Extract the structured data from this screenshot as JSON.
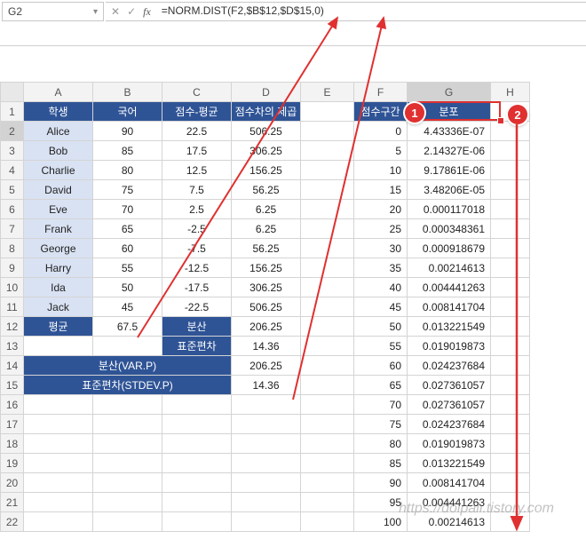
{
  "domain": "Computer-Use",
  "formula_bar": {
    "cell_ref": "G2",
    "cancel": "✕",
    "confirm": "✓",
    "fx": "fx",
    "formula": "=NORM.DIST(F2,$B$12,$D$15,0)"
  },
  "col_headers": [
    "A",
    "B",
    "C",
    "D",
    "E",
    "F",
    "G",
    "H"
  ],
  "row_headers": [
    "1",
    "2",
    "3",
    "4",
    "5",
    "6",
    "7",
    "8",
    "9",
    "10",
    "11",
    "12",
    "13",
    "14",
    "15",
    "16",
    "17",
    "18",
    "19",
    "20",
    "21",
    "22"
  ],
  "headers_left": {
    "a": "학생",
    "b": "국어",
    "c": "점수-평균",
    "d": "점수차의 제곱"
  },
  "headers_right": {
    "f": "점수구간",
    "g": "분포"
  },
  "students": [
    {
      "name": "Alice",
      "score": 90,
      "diff": "22.5",
      "sq": "506.25"
    },
    {
      "name": "Bob",
      "score": 85,
      "diff": "17.5",
      "sq": "306.25"
    },
    {
      "name": "Charlie",
      "score": 80,
      "diff": "12.5",
      "sq": "156.25"
    },
    {
      "name": "David",
      "score": 75,
      "diff": "7.5",
      "sq": "56.25"
    },
    {
      "name": "Eve",
      "score": 70,
      "diff": "2.5",
      "sq": "6.25"
    },
    {
      "name": "Frank",
      "score": 65,
      "diff": "-2.5",
      "sq": "6.25"
    },
    {
      "name": "George",
      "score": 60,
      "diff": "-7.5",
      "sq": "56.25"
    },
    {
      "name": "Harry",
      "score": 55,
      "diff": "-12.5",
      "sq": "156.25"
    },
    {
      "name": "Ida",
      "score": 50,
      "diff": "-17.5",
      "sq": "306.25"
    },
    {
      "name": "Jack",
      "score": 45,
      "diff": "-22.5",
      "sq": "506.25"
    }
  ],
  "summary": {
    "avg_label": "평균",
    "avg_val": "67.5",
    "var_label": "분산",
    "var_val": "206.25",
    "std_label": "표준편차",
    "std_val": "14.36",
    "varp_label": "분산(VAR.P)",
    "varp_val": "206.25",
    "stdevp_label": "표준편차(STDEV.P)",
    "stdevp_val": "14.36"
  },
  "dist": [
    {
      "x": "0",
      "y": "4.43336E-07"
    },
    {
      "x": "5",
      "y": "2.14327E-06"
    },
    {
      "x": "10",
      "y": "9.17861E-06"
    },
    {
      "x": "15",
      "y": "3.48206E-05"
    },
    {
      "x": "20",
      "y": "0.000117018"
    },
    {
      "x": "25",
      "y": "0.000348361"
    },
    {
      "x": "30",
      "y": "0.000918679"
    },
    {
      "x": "35",
      "y": "0.00214613"
    },
    {
      "x": "40",
      "y": "0.004441263"
    },
    {
      "x": "45",
      "y": "0.008141704"
    },
    {
      "x": "50",
      "y": "0.013221549"
    },
    {
      "x": "55",
      "y": "0.019019873"
    },
    {
      "x": "60",
      "y": "0.024237684"
    },
    {
      "x": "65",
      "y": "0.027361057"
    },
    {
      "x": "70",
      "y": "0.027361057"
    },
    {
      "x": "75",
      "y": "0.024237684"
    },
    {
      "x": "80",
      "y": "0.019019873"
    },
    {
      "x": "85",
      "y": "0.013221549"
    },
    {
      "x": "90",
      "y": "0.008141704"
    },
    {
      "x": "95",
      "y": "0.004441263"
    },
    {
      "x": "100",
      "y": "0.00214613"
    }
  ],
  "callouts": {
    "c1": "1",
    "c2": "2"
  },
  "watermark": "https://dolpali.tistory.com"
}
